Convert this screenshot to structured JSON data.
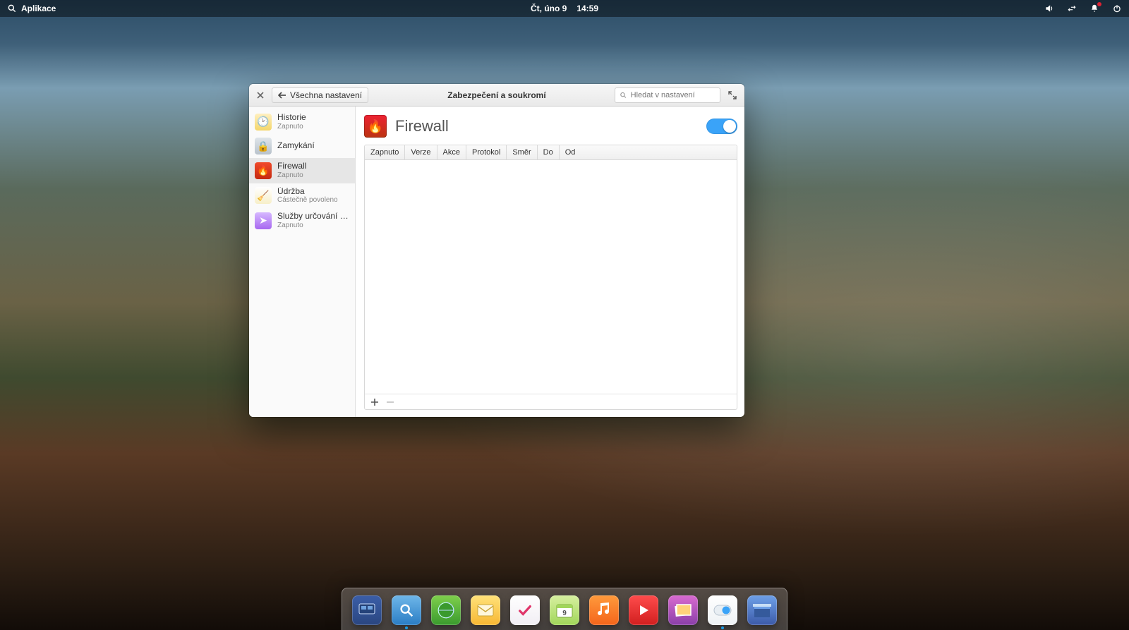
{
  "panel": {
    "applications": "Aplikace",
    "date": "Čt, úno 9",
    "time": "14:59"
  },
  "window": {
    "back_label": "Všechna nastavení",
    "title": "Zabezpečení a soukromí",
    "search_placeholder": "Hledat v nastavení"
  },
  "sidebar": {
    "items": [
      {
        "label": "Historie",
        "sub": "Zapnuto"
      },
      {
        "label": "Zamykání",
        "sub": ""
      },
      {
        "label": "Firewall",
        "sub": "Zapnuto"
      },
      {
        "label": "Údržba",
        "sub": "Částečně povoleno"
      },
      {
        "label": "Služby určování po…",
        "sub": "Zapnuto"
      }
    ]
  },
  "content": {
    "heading": "Firewall",
    "toggle_on": true,
    "columns": [
      "Zapnuto",
      "Verze",
      "Akce",
      "Protokol",
      "Směr",
      "Do",
      "Od"
    ]
  },
  "dock": {
    "apps": [
      "multitasking-view",
      "files",
      "web-browser",
      "mail",
      "tasks",
      "calendar",
      "music",
      "videos",
      "photos",
      "system-settings",
      "app-center"
    ]
  }
}
